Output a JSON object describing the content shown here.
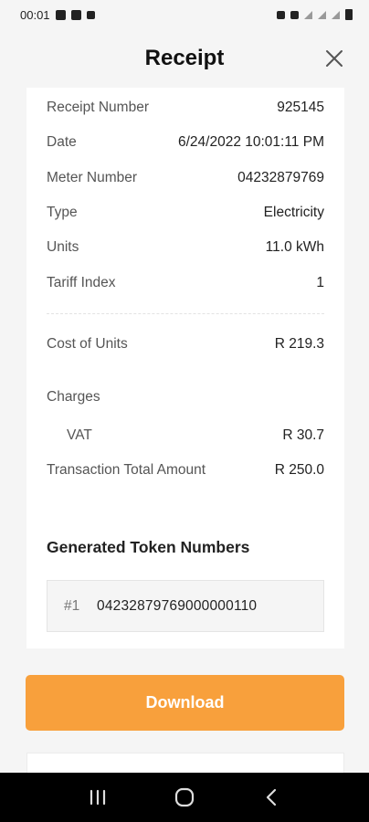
{
  "status_bar": {
    "time": "00:01"
  },
  "header": {
    "title": "Receipt",
    "close_icon": "close-icon"
  },
  "receipt": {
    "fields": [
      {
        "label": "Receipt Number",
        "value": "925145"
      },
      {
        "label": "Date",
        "value": "6/24/2022 10:01:11 PM"
      },
      {
        "label": "Meter Number",
        "value": "04232879769"
      },
      {
        "label": "Type",
        "value": "Electricity"
      },
      {
        "label": "Units",
        "value": "11.0 kWh"
      },
      {
        "label": "Tariff Index",
        "value": "1"
      }
    ],
    "cost": {
      "label": "Cost of Units",
      "value": "R 219.3"
    },
    "charges_label": "Charges",
    "vat": {
      "label": "VAT",
      "value": "R 30.7"
    },
    "total": {
      "label": "Transaction Total Amount",
      "value": "R 250.0"
    }
  },
  "tokens": {
    "title": "Generated Token Numbers",
    "items": [
      {
        "index": "#1",
        "value": "04232879769000000110"
      }
    ]
  },
  "actions": {
    "download_label": "Download"
  },
  "colors": {
    "accent": "#f8a03c"
  }
}
